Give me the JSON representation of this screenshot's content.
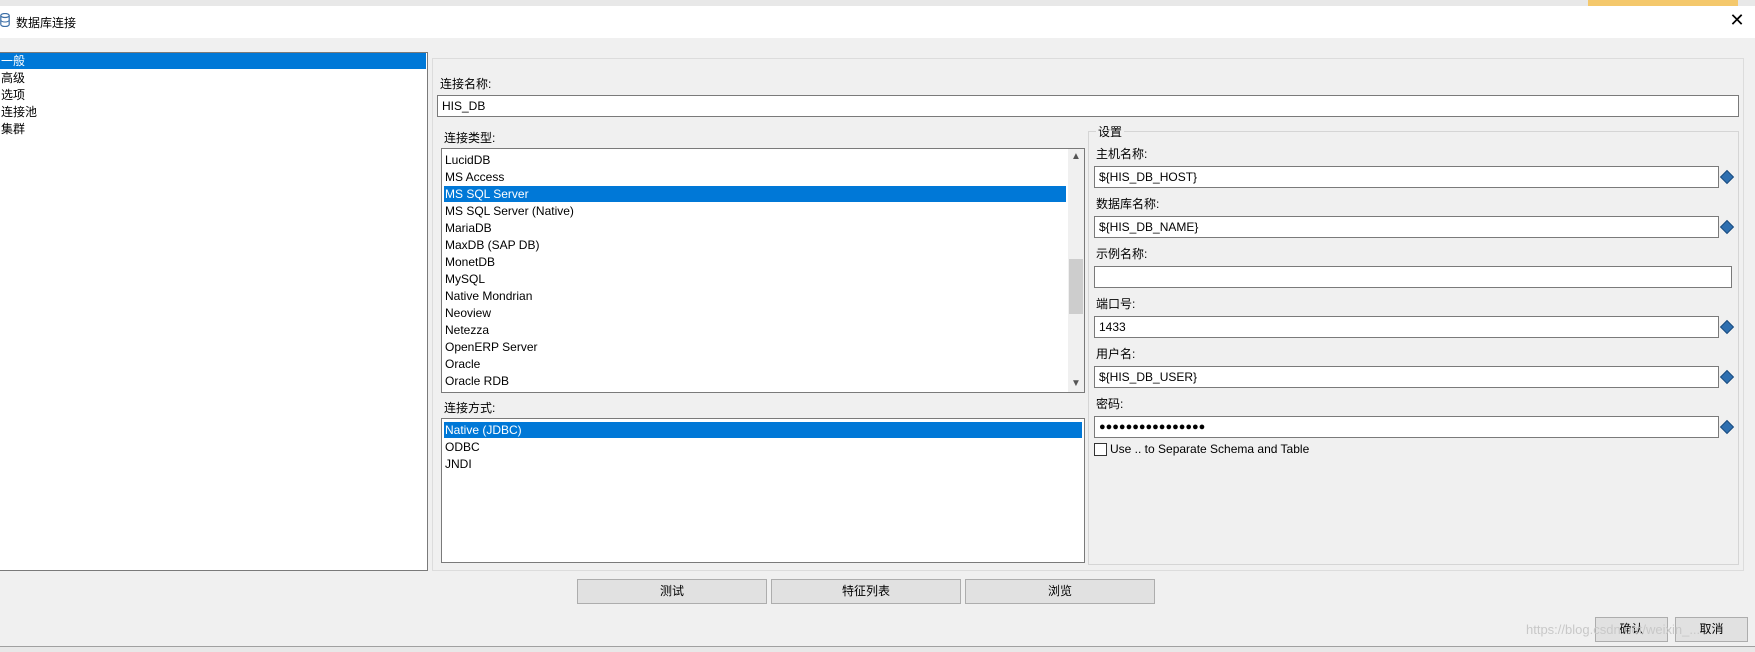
{
  "window": {
    "title": "数据库连接",
    "close_glyph": "✕"
  },
  "nav": {
    "items": [
      {
        "label": "一般",
        "selected": true
      },
      {
        "label": "高级",
        "selected": false
      },
      {
        "label": "选项",
        "selected": false
      },
      {
        "label": "连接池",
        "selected": false
      },
      {
        "label": "集群",
        "selected": false
      }
    ]
  },
  "connection_name": {
    "label": "连接名称:",
    "value": "HIS_DB"
  },
  "connection_type": {
    "label": "连接类型:",
    "items": [
      "LucidDB",
      "MS Access",
      "MS SQL Server",
      "MS SQL Server (Native)",
      "MariaDB",
      "MaxDB (SAP DB)",
      "MonetDB",
      "MySQL",
      "Native Mondrian",
      "Neoview",
      "Netezza",
      "OpenERP Server",
      "Oracle",
      "Oracle RDB"
    ],
    "selected": "MS SQL Server"
  },
  "access_method": {
    "label": "连接方式:",
    "items": [
      "Native (JDBC)",
      "ODBC",
      "JNDI"
    ],
    "selected": "Native (JDBC)"
  },
  "settings": {
    "title": "设置",
    "host": {
      "label": "主机名称:",
      "value": "${HIS_DB_HOST}"
    },
    "database": {
      "label": "数据库名称:",
      "value": "${HIS_DB_NAME}"
    },
    "instance": {
      "label": "示例名称:",
      "value": ""
    },
    "port": {
      "label": "端口号:",
      "value": "1433"
    },
    "username": {
      "label": "用户名:",
      "value": "${HIS_DB_USER}"
    },
    "password": {
      "label": "密码:",
      "value": "●●●●●●●●●●●●●●●●"
    },
    "separate_schema": {
      "label": "Use .. to Separate Schema and Table",
      "checked": false
    }
  },
  "buttons": {
    "test": "测试",
    "feature_list": "特征列表",
    "browse": "浏览",
    "ok": "确认",
    "cancel": "取消"
  },
  "watermark": "https://blog.csdn.net/weixin_..."
}
